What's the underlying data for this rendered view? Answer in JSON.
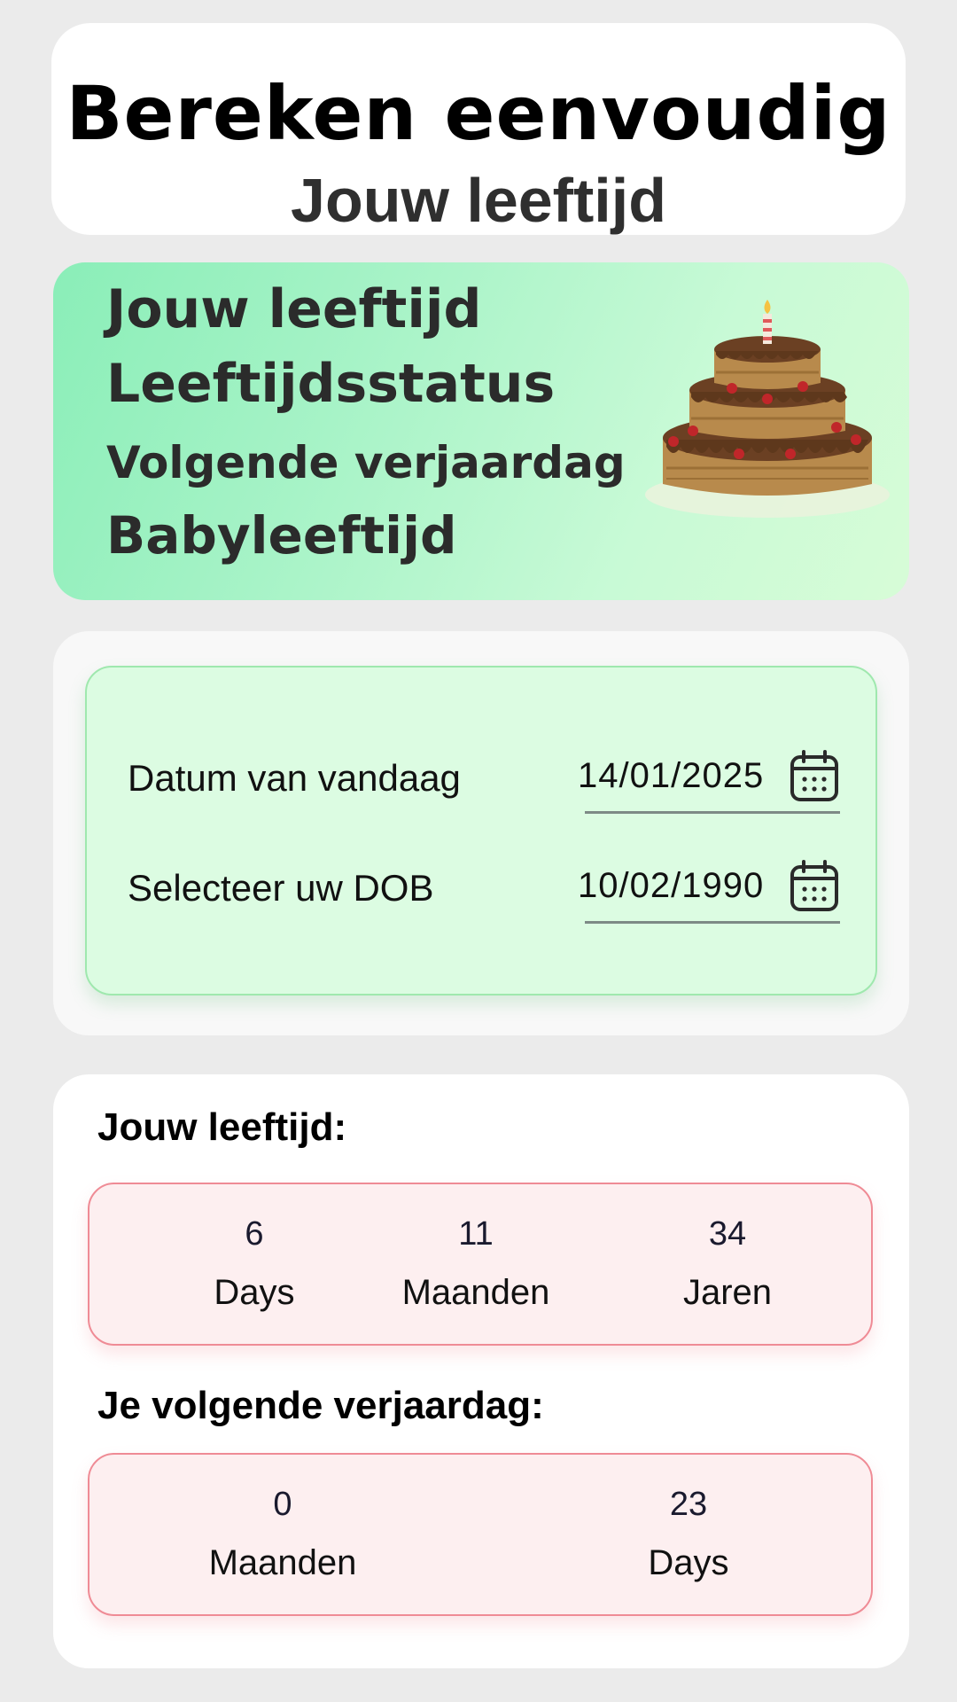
{
  "header": {
    "title": "Bereken eenvoudig",
    "subtitle": "Jouw leeftijd"
  },
  "banner": {
    "lines": [
      "Jouw leeftijd",
      "Leeftijdsstatus",
      "Volgende verjaardag",
      "Babyleeftijd"
    ],
    "image": "birthday-cake"
  },
  "inputs": {
    "today_label": "Datum van vandaag",
    "today_value": "14/01/2025",
    "dob_label": "Selecteer uw DOB",
    "dob_value": "10/02/1990",
    "icon": "calendar-icon"
  },
  "results": {
    "age_title": "Jouw leeftijd:",
    "age": [
      {
        "value": "6",
        "label": "Days"
      },
      {
        "value": "11",
        "label": "Maanden"
      },
      {
        "value": "34",
        "label": "Jaren"
      }
    ],
    "next_title": "Je volgende verjaardag:",
    "next": [
      {
        "value": "0",
        "label": "Maanden"
      },
      {
        "value": "23",
        "label": "Days"
      }
    ]
  },
  "colors": {
    "page_bg": "#ebebeb",
    "banner_green": "#a7f3c7",
    "input_bg": "#dcfce2",
    "result_pink": "#fdeff0",
    "result_border": "#ef8b95"
  }
}
